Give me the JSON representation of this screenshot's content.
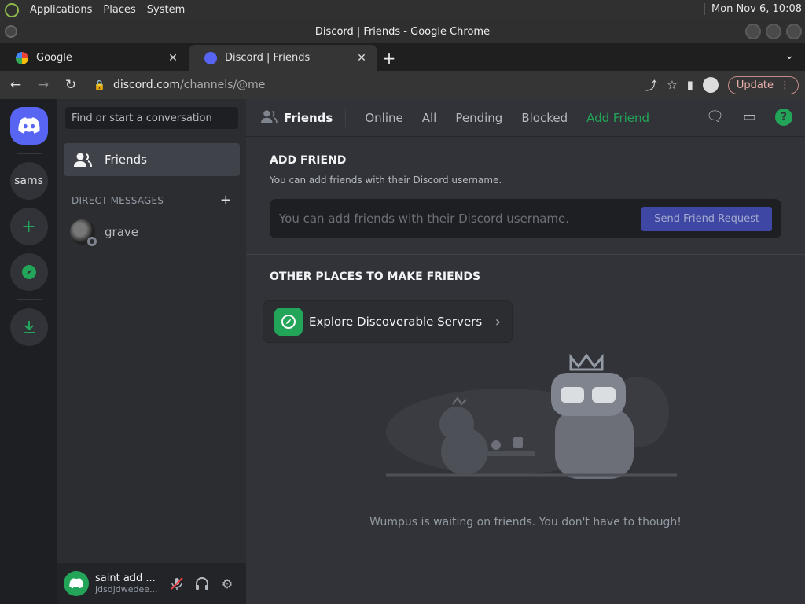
{
  "system_bar": {
    "menus": [
      "Applications",
      "Places",
      "System"
    ],
    "clock": "Mon Nov  6, 10:08"
  },
  "window": {
    "title": "Discord | Friends - Google Chrome"
  },
  "browser": {
    "tabs": [
      {
        "label": "Google",
        "favicon": "google-favicon"
      },
      {
        "label": "Discord | Friends",
        "favicon": "discord-favicon",
        "active": true
      }
    ],
    "url": {
      "host": "discord.com",
      "path": "/channels/@me"
    },
    "update_label": "Update"
  },
  "servers": {
    "items": [
      {
        "label": "",
        "icon": "discord-home-icon"
      },
      {
        "label": "sams"
      },
      {
        "label": "+",
        "icon": "add-server-icon"
      },
      {
        "label": "",
        "icon": "compass-icon"
      },
      {
        "label": "",
        "icon": "download-icon"
      }
    ]
  },
  "sidebar": {
    "search_placeholder": "Find or start a conversation",
    "friends_label": "Friends",
    "dm_header": "DIRECT MESSAGES",
    "dms": [
      {
        "name": "grave",
        "status": "offline"
      }
    ],
    "user": {
      "name": "saint add ...",
      "subtext": "jdsdjdwedee..."
    }
  },
  "topbar": {
    "title": "Friends",
    "tabs": [
      "Online",
      "All",
      "Pending",
      "Blocked",
      "Add Friend"
    ]
  },
  "add_friend": {
    "title": "ADD FRIEND",
    "description": "You can add friends with their Discord username.",
    "input_placeholder": "You can add friends with their Discord username.",
    "button": "Send Friend Request"
  },
  "other_places": {
    "title": "OTHER PLACES TO MAKE FRIENDS",
    "explore_label": "Explore Discoverable Servers"
  },
  "empty_state": {
    "text": "Wumpus is waiting on friends. You don't have to though!"
  },
  "colors": {
    "brand": "#5865f2",
    "green": "#23a559",
    "bg_main": "#313338",
    "bg_sidebar": "#2b2d31",
    "bg_servers": "#1e1f22"
  }
}
